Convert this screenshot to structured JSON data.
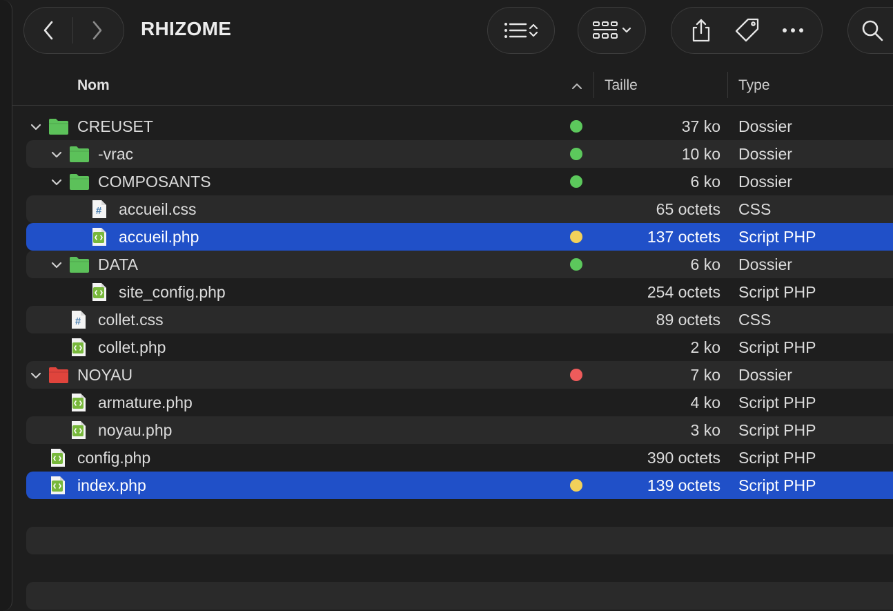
{
  "window": {
    "title": "RHIZOME"
  },
  "columns": {
    "name": "Nom",
    "size": "Taille",
    "type": "Type"
  },
  "colors": {
    "green_tag": "#5cc85c",
    "yellow_tag": "#f2d15a",
    "red_tag": "#ee5b5b",
    "selection": "#2050c8",
    "folder_green": "#5cc15a",
    "folder_red": "#e0443c"
  },
  "files": [
    {
      "name": "CREUSET",
      "size": "37 ko",
      "type": "Dossier",
      "icon": "folder-green-icon",
      "depth": 0,
      "expanded": true,
      "tag": "green"
    },
    {
      "name": "-vrac",
      "size": "10 ko",
      "type": "Dossier",
      "icon": "folder-green-icon",
      "depth": 1,
      "expanded": true,
      "tag": "green"
    },
    {
      "name": "COMPOSANTS",
      "size": "6 ko",
      "type": "Dossier",
      "icon": "folder-green-icon",
      "depth": 1,
      "expanded": true,
      "tag": "green"
    },
    {
      "name": "accueil.css",
      "size": "65 octets",
      "type": "CSS",
      "icon": "css-file-icon",
      "depth": 2
    },
    {
      "name": "accueil.php",
      "size": "137 octets",
      "type": "Script PHP",
      "icon": "php-file-icon",
      "depth": 2,
      "tag": "yellow",
      "selected": true
    },
    {
      "name": "DATA",
      "size": "6 ko",
      "type": "Dossier",
      "icon": "folder-green-icon",
      "depth": 1,
      "expanded": true,
      "tag": "green"
    },
    {
      "name": "site_config.php",
      "size": "254 octets",
      "type": "Script PHP",
      "icon": "php-file-icon",
      "depth": 2
    },
    {
      "name": "collet.css",
      "size": "89 octets",
      "type": "CSS",
      "icon": "css-file-icon",
      "depth": 1
    },
    {
      "name": "collet.php",
      "size": "2 ko",
      "type": "Script PHP",
      "icon": "php-file-icon",
      "depth": 1
    },
    {
      "name": "NOYAU",
      "size": "7 ko",
      "type": "Dossier",
      "icon": "folder-red-icon",
      "depth": 0,
      "expanded": true,
      "tag": "red"
    },
    {
      "name": "armature.php",
      "size": "4 ko",
      "type": "Script PHP",
      "icon": "php-file-icon",
      "depth": 1
    },
    {
      "name": "noyau.php",
      "size": "3 ko",
      "type": "Script PHP",
      "icon": "php-file-icon",
      "depth": 1
    },
    {
      "name": "config.php",
      "size": "390 octets",
      "type": "Script PHP",
      "icon": "php-file-icon",
      "depth": 0
    },
    {
      "name": "index.php",
      "size": "139 octets",
      "type": "Script PHP",
      "icon": "php-file-icon",
      "depth": 0,
      "tag": "yellow",
      "selected": true
    }
  ]
}
